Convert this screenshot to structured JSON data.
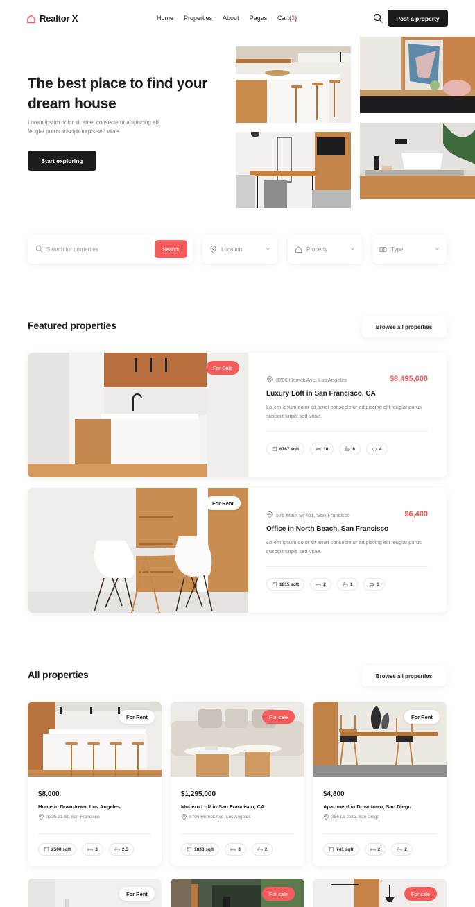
{
  "header": {
    "logo_text": "Realtor X",
    "nav": [
      "Home",
      "Properties",
      "About",
      "Pages"
    ],
    "cart_label": "Cart(",
    "cart_count": "3",
    "cart_close": ")",
    "post_button": "Post a property"
  },
  "hero": {
    "title": "The best place to find your dream house",
    "subtitle": "Lorem ipsum dolor sit amet consectetur adipiscing elit feugiat purus suscipit turpis sed vitae.",
    "cta": "Start exploring"
  },
  "search": {
    "placeholder": "Search for properties",
    "button": "Search",
    "location": "Location",
    "property": "Property",
    "type": "Type"
  },
  "featured": {
    "title": "Featured properties",
    "browse": "Browse all properties",
    "items": [
      {
        "badge": "For Sale",
        "address": "8706 Herrick Ave, Los Angeles",
        "price": "$8,495,000",
        "name": "Luxury Loft in San Francisco, CA",
        "desc": "Lorem ipsum dolor sit amet consectetur adipiscing elit feugiat purus suscipit turpis sed vitae.",
        "sqft": "6767 sqft",
        "beds": "10",
        "baths": "8",
        "garage": "4"
      },
      {
        "badge": "For Rent",
        "address": "575 Main St 401, San Francisco",
        "price": "$6,400",
        "name": "Office in North Beach, San Francisco",
        "desc": "Lorem ipsum dolor sit amet consectetur adipiscing elit feugiat purus suscipit turpis sed vitae.",
        "sqft": "1815 sqft",
        "beds": "2",
        "baths": "1",
        "garage": "3"
      }
    ]
  },
  "all": {
    "title": "All properties",
    "browse": "Browse all properties",
    "items": [
      {
        "badge": "For Rent",
        "price": "$8,000",
        "name": "Home in Downtown, Los Angeles",
        "address": "3335 21 St, San Francisco",
        "sqft": "2508 sqft",
        "beds": "3",
        "baths": "2.5"
      },
      {
        "badge": "For sale",
        "price": "$1,295,000",
        "name": "Modern Loft in San Francisco, CA",
        "address": "8706 Herrick Ave, Los Angeles",
        "sqft": "1833 sqft",
        "beds": "3",
        "baths": "2"
      },
      {
        "badge": "For Rent",
        "price": "$4,800",
        "name": "Apartment in Downtown, San Diego",
        "address": "356 La Jolla, San Diego",
        "sqft": "741 sqft",
        "beds": "2",
        "baths": "2"
      }
    ],
    "next_badges": [
      "For Rent",
      "For sale",
      "For sale"
    ]
  },
  "colors": {
    "accent": "#f25c5c",
    "dark": "#1c1c1e",
    "muted": "#7a7a80"
  },
  "icons": [
    "logo-house-icon",
    "search-icon",
    "location-pin-icon",
    "home-icon",
    "dollar-icon",
    "chevron-down-icon",
    "area-icon",
    "bed-icon",
    "bath-icon",
    "garage-icon"
  ]
}
